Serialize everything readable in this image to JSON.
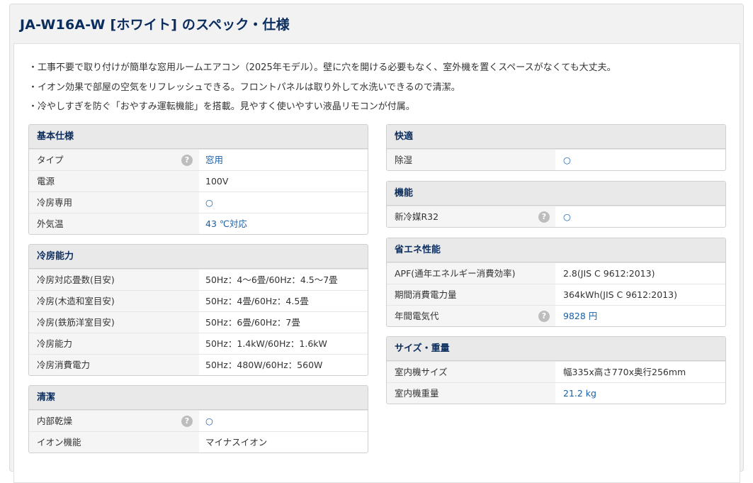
{
  "page_title": "JA-W16A-W [ホワイト] のスペック・仕様",
  "bullets": [
    "工事不要で取り付けが簡単な窓用ルームエアコン（2025年モデル）。壁に穴を開ける必要もなく、室外機を置くスペースがなくても大丈夫。",
    "イオン効果で部屋の空気をリフレッシュできる。フロントパネルは取り外して水洗いできるので清潔。",
    "冷やしすぎを防ぐ「おやすみ運転機能」を搭載。見やすく使いやすい液晶リモコンが付属。"
  ],
  "help_glyph": "?",
  "sections": {
    "basic": {
      "title": "基本仕様",
      "rows": [
        {
          "label": "タイプ",
          "value": "窓用"
        },
        {
          "label": "電源",
          "value": "100V"
        },
        {
          "label": "冷房専用",
          "value": "○"
        },
        {
          "label": "外気温",
          "value": "43 ℃対応"
        }
      ]
    },
    "cooling": {
      "title": "冷房能力",
      "rows": [
        {
          "label": "冷房対応畳数(目安)",
          "value": "50Hz：4～6畳/60Hz：4.5～7畳"
        },
        {
          "label": "冷房(木造和室目安)",
          "value": "50Hz：4畳/60Hz：4.5畳"
        },
        {
          "label": "冷房(鉄筋洋室目安)",
          "value": "50Hz：6畳/60Hz：7畳"
        },
        {
          "label": "冷房能力",
          "value": "50Hz：1.4kW/60Hz：1.6kW"
        },
        {
          "label": "冷房消費電力",
          "value": "50Hz：480W/60Hz：560W"
        }
      ]
    },
    "clean": {
      "title": "清潔",
      "rows": [
        {
          "label": "内部乾燥",
          "value": "○"
        },
        {
          "label": "イオン機能",
          "value": "マイナスイオン"
        }
      ]
    },
    "comfort": {
      "title": "快適",
      "rows": [
        {
          "label": "除湿",
          "value": "○"
        }
      ]
    },
    "function": {
      "title": "機能",
      "rows": [
        {
          "label": "新冷媒R32",
          "value": "○"
        }
      ]
    },
    "energy": {
      "title": "省エネ性能",
      "rows": [
        {
          "label": "APF(通年エネルギー消費効率)",
          "value": "2.8(JIS C 9612:2013)"
        },
        {
          "label": "期間消費電力量",
          "value": "364kWh(JIS C 9612:2013)"
        },
        {
          "label": "年間電気代",
          "value": "9828 円"
        }
      ]
    },
    "size": {
      "title": "サイズ・重量",
      "rows": [
        {
          "label": "室内機サイズ",
          "value": "幅335x高さ770x奥行256mm"
        },
        {
          "label": "室内機重量",
          "value": "21.2 kg"
        }
      ]
    }
  }
}
